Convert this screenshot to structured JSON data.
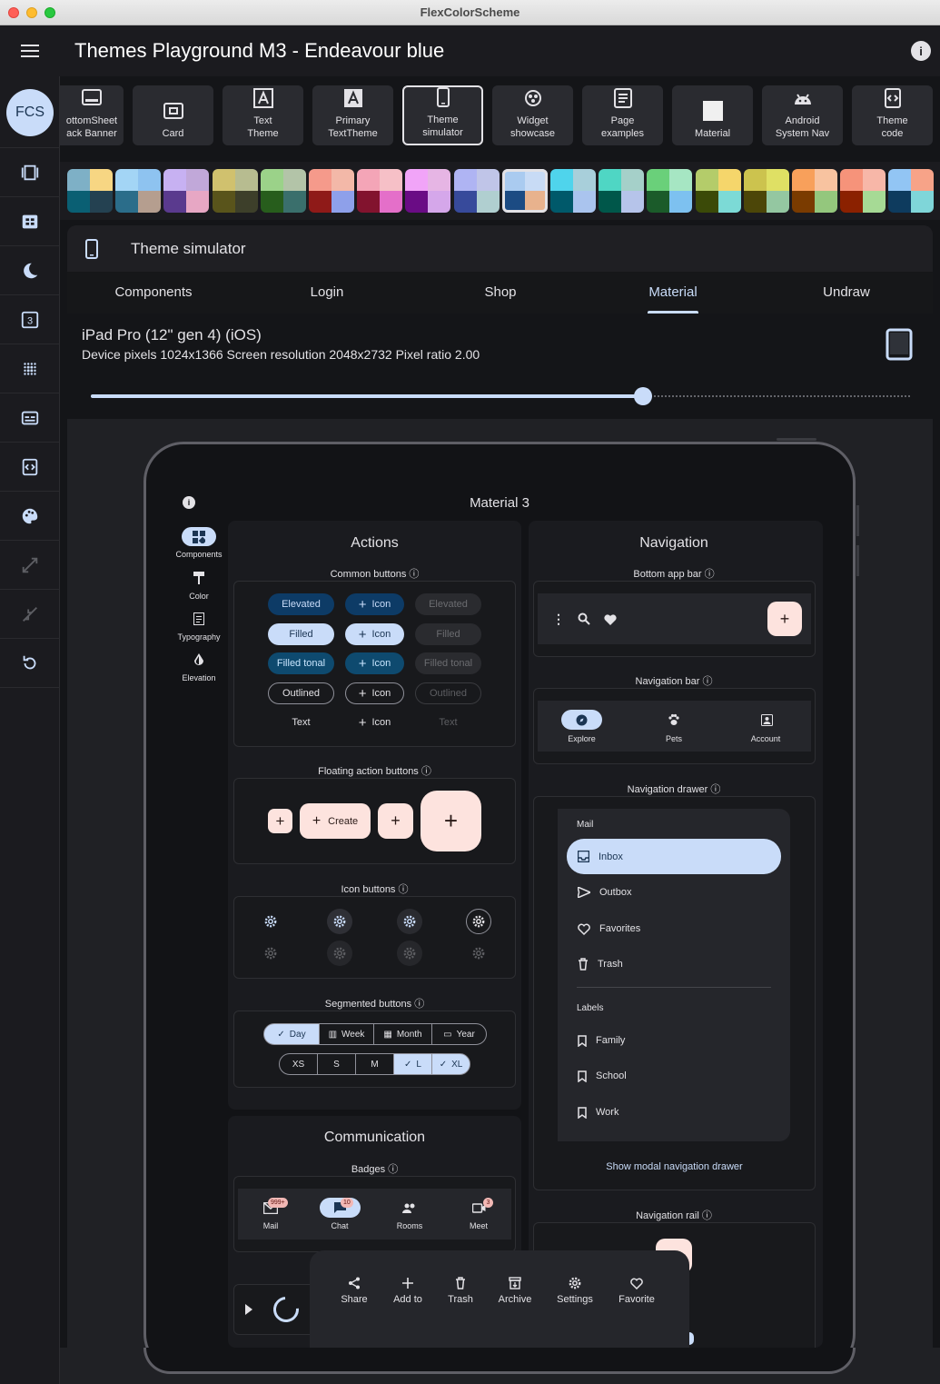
{
  "window": {
    "title": "FlexColorScheme"
  },
  "appbar": {
    "title": "Themes Playground M3 - Endeavour blue",
    "avatar": "FCS"
  },
  "panels": [
    {
      "label": "ottomSheet\nack Banner",
      "icon": "bottomsheet-icon"
    },
    {
      "label": "Card",
      "icon": "card-icon"
    },
    {
      "label": "Text\nTheme",
      "icon": "text-theme-icon"
    },
    {
      "label": "Primary\nTextTheme",
      "icon": "primary-text-theme-icon"
    },
    {
      "label": "Theme\nsimulator",
      "icon": "phone-icon",
      "selected": true
    },
    {
      "label": "Widget\nshowcase",
      "icon": "widgets-icon"
    },
    {
      "label": "Page\nexamples",
      "icon": "page-icon"
    },
    {
      "label": "Material",
      "icon": "material-icon"
    },
    {
      "label": "Android\nSystem Nav",
      "icon": "android-icon"
    },
    {
      "label": "Theme\ncode",
      "icon": "code-icon"
    }
  ],
  "simulator": {
    "title": "Theme simulator",
    "tabs": [
      "Components",
      "Login",
      "Shop",
      "Material",
      "Undraw"
    ],
    "selected_tab": "Material",
    "device_name": "iPad Pro (12\" gen 4) (iOS)",
    "device_info": "Device pixels 1024x1366  Screen resolution 2048x2732  Pixel ratio 2.00",
    "slider_value": 0.67
  },
  "material": {
    "title": "Material 3",
    "rail": [
      "Components",
      "Color",
      "Typography",
      "Elevation"
    ],
    "actions_title": "Actions",
    "common_buttons_label": "Common buttons",
    "buttons": {
      "elevated": "Elevated",
      "filled": "Filled",
      "filled_tonal": "Filled tonal",
      "outlined": "Outlined",
      "text": "Text",
      "icon": "Icon"
    },
    "fab_label": "Floating action buttons",
    "fab_create": "Create",
    "icon_buttons_label": "Icon buttons",
    "segmented_label": "Segmented buttons",
    "seg1": [
      "Day",
      "Week",
      "Month",
      "Year"
    ],
    "seg2": [
      "XS",
      "S",
      "M",
      "L",
      "XL"
    ],
    "communication_title": "Communication",
    "badges_label": "Badges",
    "badges": [
      {
        "label": "Mail",
        "badge": "999+"
      },
      {
        "label": "Chat",
        "badge": "10"
      },
      {
        "label": "Rooms",
        "badge": ""
      },
      {
        "label": "Meet",
        "badge": "3"
      }
    ],
    "navigation_title": "Navigation",
    "bottom_app_bar_label": "Bottom app bar",
    "navigation_bar_label": "Navigation bar",
    "nav_bar": [
      "Explore",
      "Pets",
      "Account"
    ],
    "navigation_drawer_label": "Navigation drawer",
    "drawer_header": "Mail",
    "drawer_items": [
      "Inbox",
      "Outbox",
      "Favorites",
      "Trash"
    ],
    "drawer_labels_header": "Labels",
    "drawer_labels": [
      "Family",
      "School",
      "Work"
    ],
    "show_modal_drawer": "Show modal navigation drawer",
    "navigation_rail_label": "Navigation rail",
    "bottom_sheet_actions": [
      "Share",
      "Add to",
      "Trash",
      "Archive",
      "Settings",
      "Favorite"
    ]
  },
  "colors": {
    "background": "#141518",
    "primary_container": "#c9dcf9",
    "fab": "#fde3de",
    "tonal": "#0e4a6f",
    "elevated_bg": "#0d3b66"
  }
}
